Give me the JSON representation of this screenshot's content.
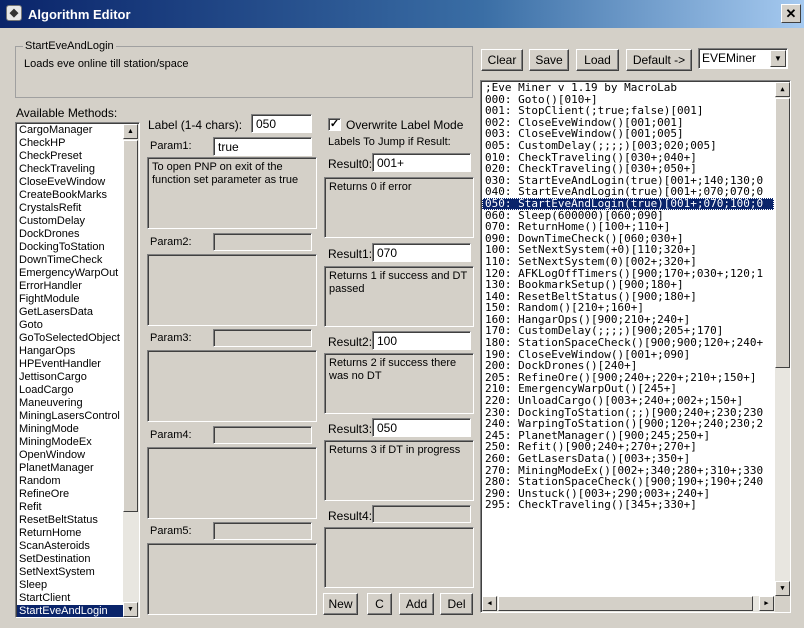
{
  "window": {
    "title": "Algorithm Editor",
    "close_glyph": "✕",
    "icon": "app-icon"
  },
  "algorithm": {
    "name": "StartEveAndLogin",
    "description": "Loads eve online till station/space"
  },
  "methods": {
    "header": "Available Methods:",
    "items": [
      "CargoManager",
      "CheckHP",
      "CheckPreset",
      "CheckTraveling",
      "CloseEveWindow",
      "CreateBookMarks",
      "CrystalsRefit",
      "CustomDelay",
      "DockDrones",
      "DockingToStation",
      "DownTimeCheck",
      "EmergencyWarpOut",
      "ErrorHandler",
      "FightModule",
      "GetLasersData",
      "Goto",
      "GoToSelectedObject",
      "HangarOps",
      "HPEventHandler",
      "JettisonCargo",
      "LoadCargo",
      "Maneuvering",
      "MiningLasersControl",
      "MiningMode",
      "MiningModeEx",
      "OpenWindow",
      "PlanetManager",
      "Random",
      "RefineOre",
      "Refit",
      "ResetBeltStatus",
      "ReturnHome",
      "ScanAsteroids",
      "SetDestination",
      "SetNextSystem",
      "Sleep",
      "StartClient",
      "StartEveAndLogin"
    ],
    "selected": "StartEveAndLogin"
  },
  "label": {
    "caption": "Label (1-4 chars):",
    "value": "050"
  },
  "params": [
    {
      "caption": "Param1:",
      "value": "true",
      "description": "To open PNP on exit of the function set parameter as true"
    },
    {
      "caption": "Param2:",
      "value": "",
      "description": ""
    },
    {
      "caption": "Param3:",
      "value": "",
      "description": ""
    },
    {
      "caption": "Param4:",
      "value": "",
      "description": ""
    },
    {
      "caption": "Param5:",
      "value": "",
      "description": ""
    }
  ],
  "overwrite": {
    "caption": "Overwrite Label Mode",
    "checked": "✓"
  },
  "jump_header": "Labels To Jump if Result:",
  "results": [
    {
      "caption": "Result0:",
      "value": "001+",
      "description": "Returns 0 if error"
    },
    {
      "caption": "Result1:",
      "value": "070",
      "description": "Returns 1 if success and DT passed"
    },
    {
      "caption": "Result2:",
      "value": "100",
      "description": "Returns 2 if success there was no DT"
    },
    {
      "caption": "Result3:",
      "value": "050",
      "description": "Returns 3 if DT in progress"
    },
    {
      "caption": "Result4:",
      "value": "",
      "description": ""
    }
  ],
  "buttons": {
    "new": "New",
    "c": "C",
    "add": "Add",
    "del": "Del",
    "clear": "Clear",
    "save": "Save",
    "load": "Load",
    "default": "Default ->"
  },
  "profile": {
    "selected": "EVEMiner"
  },
  "code": {
    "lines": [
      ";Eve Miner v 1.19 by MacroLab",
      "000: Goto()[010+]",
      "001: StopClient(;true;false)[001]",
      "002: CloseEveWindow()[001;001]",
      "003: CloseEveWindow()[001;005]",
      "005: CustomDelay(;;;;)[003;020;005]",
      "010: CheckTraveling()[030+;040+]",
      "020: CheckTraveling()[030+;050+]",
      "030: StartEveAndLogin(true)[001+;140;130;0",
      "040: StartEveAndLogin(true)[001+;070;070;0",
      "050: StartEveAndLogin(true)[001+;070;100;0",
      "060: Sleep(600000)[060;090]",
      "070: ReturnHome()[100+;110+]",
      "090: DownTimeCheck()[060;030+]",
      "100: SetNextSystem(+0)[110;320+]",
      "110: SetNextSystem(0)[002+;320+]",
      "120: AFKLogOffTimers()[900;170+;030+;120;1",
      "130: BookmarkSetup()[900;180+]",
      "140: ResetBeltStatus()[900;180+]",
      "150: Random()[210+;160+]",
      "160: HangarOps()[900;210+;240+]",
      "170: CustomDelay(;;;;)[900;205+;170]",
      "180: StationSpaceCheck()[900;900;120+;240+",
      "190: CloseEveWindow()[001+;090]",
      "200: DockDrones()[240+]",
      "205: RefineOre()[900;240+;220+;210+;150+]",
      "210: EmergencyWarpOut()[245+]",
      "220: UnloadCargo()[003+;240+;002+;150+]",
      "230: DockingToStation(;;)[900;240+;230;230",
      "240: WarpingToStation()[900;120+;240;230;2",
      "245: PlanetManager()[900;245;250+]",
      "250: Refit()[900;240+;270+;270+]",
      "260: GetLasersData()[003+;350+]",
      "270: MiningModeEx()[002+;340;280+;310+;330",
      "280: StationSpaceCheck()[900;190+;190+;240",
      "290: Unstuck()[003+;290;003+;240+]",
      "295: CheckTraveling()[345+;330+]"
    ],
    "selected": "050: StartEveAndLogin(true)[001+;070;100;0"
  },
  "icons": {
    "scroll_up": "▲",
    "scroll_down": "▼",
    "scroll_left": "◀",
    "scroll_right": "▶",
    "dropdown": "▼"
  }
}
